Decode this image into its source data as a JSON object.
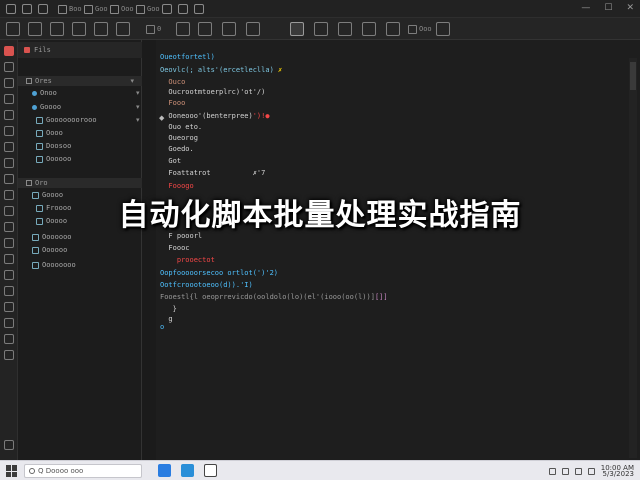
{
  "window": {
    "top_labels": [
      "Boo",
      "Goo",
      "Ooo",
      "Goo"
    ],
    "win_buttons": [
      "—",
      "☐",
      "✕"
    ]
  },
  "toolbar": {
    "chip_labels": [
      "0",
      "Ooo"
    ]
  },
  "sidebar": {
    "header": "Fils",
    "section1": "Ores",
    "section2": "Oro",
    "items1": [
      "Onoo",
      "Goooo",
      "Gooooooorooo",
      "Oooo",
      "Doosoo",
      "Oooooo"
    ],
    "items2": [
      "Goooo",
      "Froooo",
      "Ooooo",
      "Ooooooo",
      "Oooooo",
      "Oooooooo"
    ]
  },
  "code": {
    "lines": [
      {
        "text": "Oueotfortetl)",
        "cls": "c-blue"
      },
      {
        "text": "Oeovlc(; alts'(ercetleclla) ",
        "cls": "c-cyan",
        "tail": "✗",
        "tailcls": "c-yellow"
      },
      {
        "text": "  Ouco",
        "cls": "c-orange"
      },
      {
        "text": "  Oucrootmtoerplrc)'ot'/)",
        "cls": "c-white"
      },
      {
        "text": "  Fooo",
        "cls": "c-orange"
      },
      {
        "text": "  Ooneooo'(benterpree)",
        "cls": "c-white",
        "tail": "')!●",
        "tailcls": "c-red"
      },
      {
        "text": "  Ouo eto.",
        "cls": "c-white"
      },
      {
        "text": "  Oueorog",
        "cls": "c-white"
      },
      {
        "text": "  Goedo.",
        "cls": "c-white"
      },
      {
        "text": "  Got",
        "cls": "c-white"
      },
      {
        "text": "  Foattatrot          ✗'7",
        "cls": "c-white"
      },
      {
        "text": "  Fooogo",
        "cls": "c-red"
      },
      {
        "text": "  F pooorl",
        "cls": "c-white"
      },
      {
        "text": "  Foooc",
        "cls": "c-white"
      },
      {
        "text": "    prooectot",
        "cls": "c-red"
      },
      {
        "text": "Oopfooooorsecoo ortlot(')'2)",
        "cls": "c-blue"
      },
      {
        "text": "Ootfcroootoeoo(d)).'I)",
        "cls": "c-blue"
      },
      {
        "text": "Fooestl{l oeoprrevicdo(ooldolo(lo)(el'(iooo(oo(l))]",
        "cls": "c-gray",
        "tail": "[]]",
        "tailcls": "c-pink"
      },
      {
        "text": "   }",
        "cls": "c-white"
      },
      {
        "text": "  g",
        "cls": "c-white"
      },
      {
        "text": "o",
        "cls": "c-blue"
      }
    ]
  },
  "overlay": {
    "title": "自动化脚本批量处理实战指南"
  },
  "taskbar": {
    "search_placeholder": "Q Doooo ooo",
    "time": "10:00 AM",
    "date": "5/3/2023"
  },
  "colors": {
    "accent_red": "#d9534f",
    "badge_orange": "#ff9f1a",
    "keyword_blue": "#4fc1ff"
  }
}
